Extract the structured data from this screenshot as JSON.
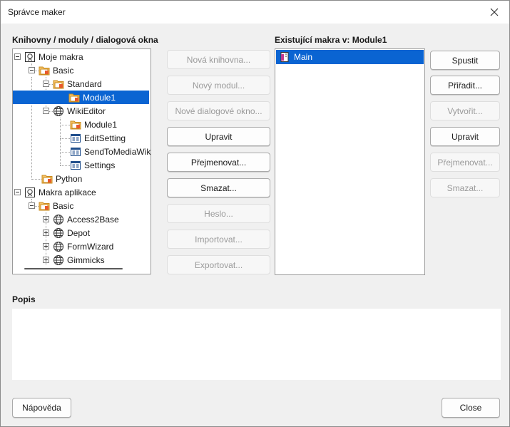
{
  "window": {
    "title": "Správce maker"
  },
  "library_section": {
    "label": "Knihovny / moduly / dialogová okna",
    "tree": [
      {
        "label": "Moje makra",
        "icon": "macros-root-icon"
      },
      {
        "label": "Basic",
        "icon": "folder-icon"
      },
      {
        "label": "Standard",
        "icon": "folder-icon"
      },
      {
        "label": "Module1",
        "icon": "module-icon",
        "selected": true
      },
      {
        "label": "WikiEditor",
        "icon": "library-globe-icon"
      },
      {
        "label": "Module1",
        "icon": "module-icon"
      },
      {
        "label": "EditSetting",
        "icon": "dialog-icon"
      },
      {
        "label": "SendToMediaWik",
        "icon": "dialog-icon"
      },
      {
        "label": "Settings",
        "icon": "dialog-icon"
      },
      {
        "label": "Python",
        "icon": "folder-icon"
      },
      {
        "label": "Makra aplikace",
        "icon": "macros-root-icon"
      },
      {
        "label": "Basic",
        "icon": "folder-icon"
      },
      {
        "label": "Access2Base",
        "icon": "library-globe-icon"
      },
      {
        "label": "Depot",
        "icon": "library-globe-icon"
      },
      {
        "label": "FormWizard",
        "icon": "library-globe-icon"
      },
      {
        "label": "Gimmicks",
        "icon": "library-globe-icon"
      }
    ]
  },
  "library_buttons": {
    "new_library": "Nová knihovna...",
    "new_module": "Nový modul...",
    "new_dialog": "Nové dialogové okno...",
    "edit": "Upravit",
    "rename": "Přejmenovat...",
    "delete": "Smazat...",
    "password": "Heslo...",
    "import": "Importovat...",
    "export": "Exportovat..."
  },
  "macros_section": {
    "label": "Existující makra v: Module1",
    "items": [
      {
        "label": "Main",
        "icon": "macro-icon",
        "selected": true
      }
    ]
  },
  "macro_buttons": {
    "run": "Spustit",
    "assign": "Přiřadit...",
    "create": "Vytvořit...",
    "edit": "Upravit",
    "rename": "Přejmenovat...",
    "delete": "Smazat..."
  },
  "description": {
    "label": "Popis",
    "text": ""
  },
  "footer": {
    "help": "Nápověda",
    "close": "Close"
  },
  "colors": {
    "selection": "#0a64d2",
    "dialog_bg": "#f0f0f0"
  }
}
